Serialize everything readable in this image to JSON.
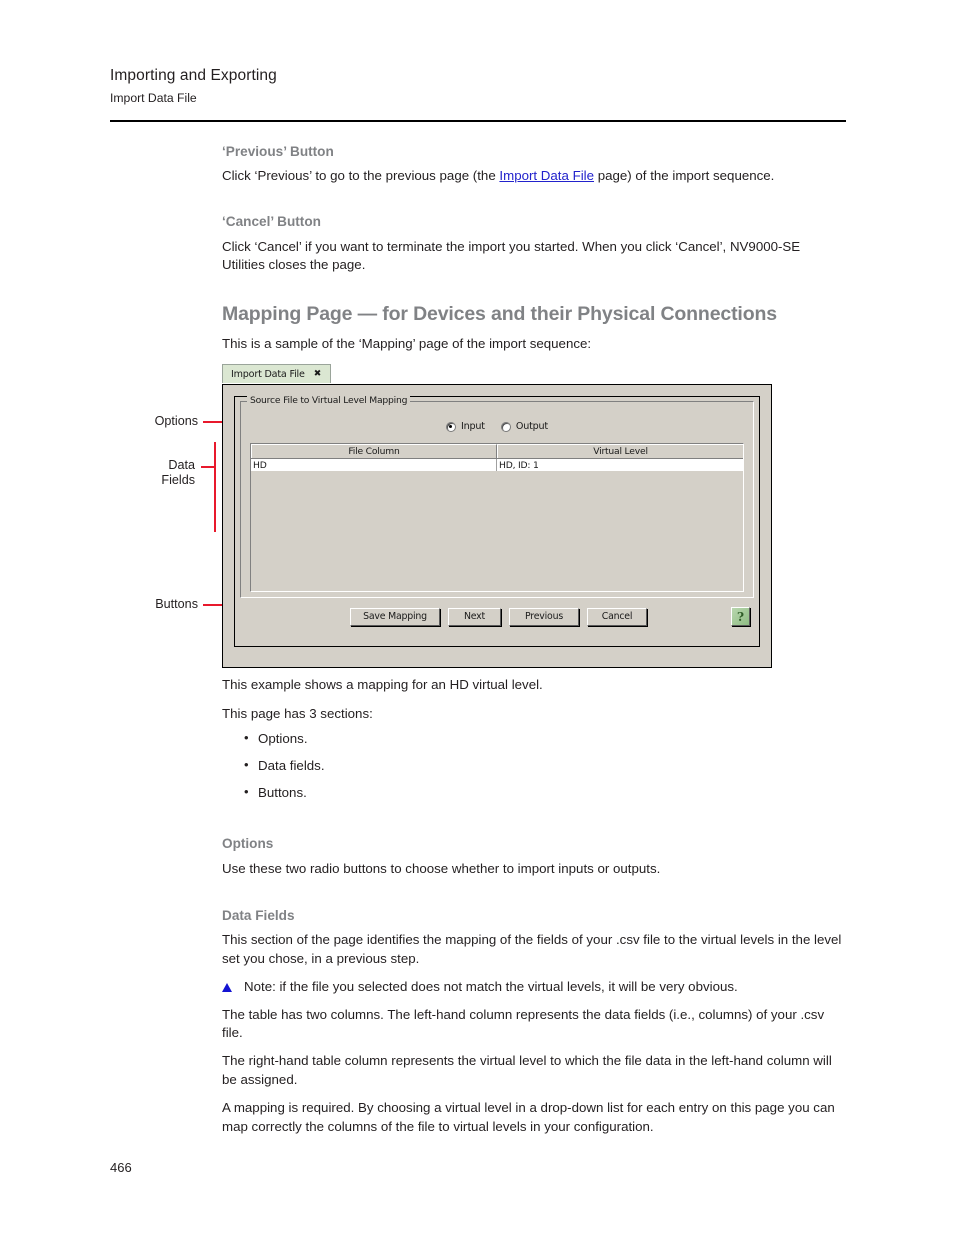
{
  "header": {
    "title": "Importing and Exporting",
    "subtitle": "Import Data File"
  },
  "sections": {
    "previous_button": {
      "heading": "‘Previous’ Button",
      "body_before_link": "Click ‘Previous’ to go to the previous page (the ",
      "link": "Import Data File",
      "body_after_link": " page) of the import sequence."
    },
    "cancel_button": {
      "heading": "‘Cancel’ Button",
      "body": "Click ‘Cancel’ if you want to terminate the import you started. When you click ‘Cancel’, NV9000-SE Utilities closes the page."
    },
    "mapping_page": {
      "heading": "Mapping Page — for Devices and their Physical Connections",
      "intro": "This is a sample of the ‘Mapping’ page of the import sequence:",
      "after_example": "This example shows a mapping for an HD virtual level.",
      "sections_intro": "This page has 3 sections:",
      "bullets": [
        "Options.",
        "Data fields.",
        "Buttons."
      ]
    },
    "options": {
      "heading": "Options",
      "body": "Use these two radio buttons to choose whether to import inputs or outputs."
    },
    "data_fields": {
      "heading": "Data Fields",
      "body1": "This section of the page identifies the mapping of the fields of your .csv file to the virtual levels in the level set you chose, in a previous step.",
      "note": "Note: if the file you selected does not match the virtual levels, it will be very obvious.",
      "body2": "The table has two columns. The left-hand column represents the data fields (i.e., columns) of your .csv file.",
      "body3": "The right-hand table column represents the virtual level to which the file data in the left-hand column will be assigned.",
      "body4": "A mapping is required. By choosing a virtual level in a drop-down list for each entry on this page you can map correctly the columns of the file to virtual levels in your configuration."
    }
  },
  "callouts": {
    "options": "Options",
    "data_fields_line1": "Data",
    "data_fields_line2": "Fields",
    "buttons": "Buttons"
  },
  "screenshot": {
    "tab": {
      "label": "Import Data File",
      "close": "✖"
    },
    "groupbox_title": "Source File to Virtual Level Mapping",
    "radios": [
      {
        "label": "Input",
        "checked": true
      },
      {
        "label": "Output",
        "checked": false
      }
    ],
    "table": {
      "columns": [
        "File Column",
        "Virtual Level"
      ],
      "rows": [
        [
          "HD",
          "HD, ID: 1"
        ]
      ]
    },
    "buttons": [
      "Save Mapping",
      "Next",
      "Previous",
      "Cancel"
    ],
    "help_glyph": "?"
  },
  "folio": "466",
  "colors": {
    "heading_gray": "#808285",
    "link_blue": "#2222cc",
    "callout_red": "#e8192c",
    "dialog_face": "#d4d0c8",
    "tab_green": "#dbe7d2",
    "note_triangle_blue": "#1414d2"
  }
}
